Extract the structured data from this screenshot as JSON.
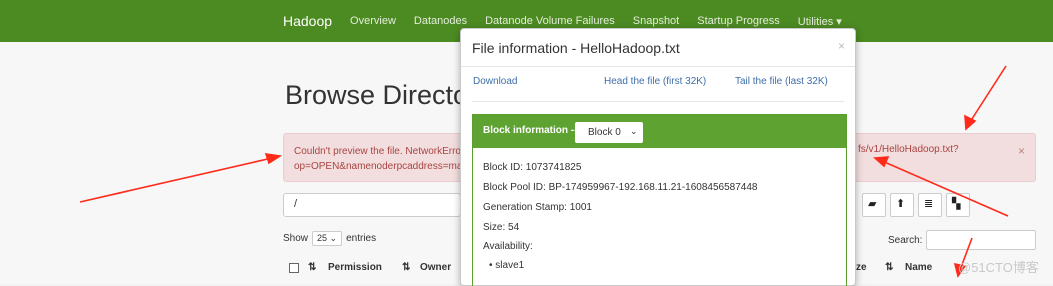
{
  "navbar": {
    "brand": "Hadoop",
    "links": [
      "Overview",
      "Datanodes",
      "Datanode Volume Failures",
      "Snapshot",
      "Startup Progress",
      "Utilities"
    ]
  },
  "page": {
    "title": "Browse Directory",
    "alert_left": "Couldn't preview the file. NetworkErro",
    "alert_left_2": "op=OPEN&namenoderpcaddress=ma",
    "alert_right": "fs/v1/HelloHadoop.txt?",
    "alert_close": "×",
    "path_value": "/",
    "show_label": "Show",
    "entries_value": "25",
    "entries_label": "entries",
    "search_label": "Search:",
    "columns": [
      "Permission",
      "Owner",
      "ze",
      "Name"
    ]
  },
  "modal": {
    "title": "File information - HelloHadoop.txt",
    "close": "×",
    "links": {
      "download": "Download",
      "head": "Head the file (first 32K)",
      "tail": "Tail the file (last 32K)"
    },
    "block_label": "Block information --",
    "block_selected": "Block 0",
    "block_id": "Block ID: 1073741825",
    "block_pool_id": "Block Pool ID: BP-174959967-192.168.11.21-1608456587448",
    "generation_stamp": "Generation Stamp: 1001",
    "size": "Size: 54",
    "availability_label": "Availability:",
    "availability_nodes": [
      "slave1"
    ]
  },
  "watermark": "@51CTO博客",
  "colors": {
    "navbar": "#4c8a22",
    "panel_header": "#5ea332",
    "arrow": "#ff2a1a",
    "link": "#3f6ea8"
  }
}
